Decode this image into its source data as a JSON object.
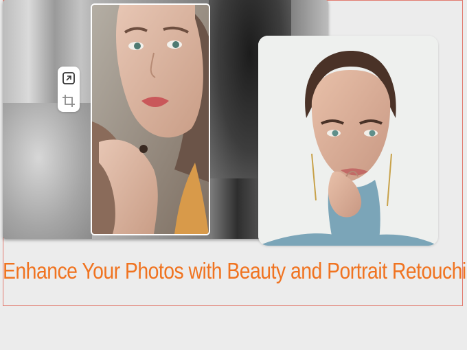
{
  "headline": "Enhance Your Photos with Beauty and Portrait Retouching",
  "toolbar": {
    "tools": [
      {
        "name": "expand-icon"
      },
      {
        "name": "crop-icon"
      }
    ]
  },
  "colors": {
    "headline": "#f07320",
    "outline": "#e27b6f",
    "background": "#ececec",
    "sweater": "#7ba5b8",
    "lips": "#c9585a",
    "eyes": "#5f8f8a"
  }
}
